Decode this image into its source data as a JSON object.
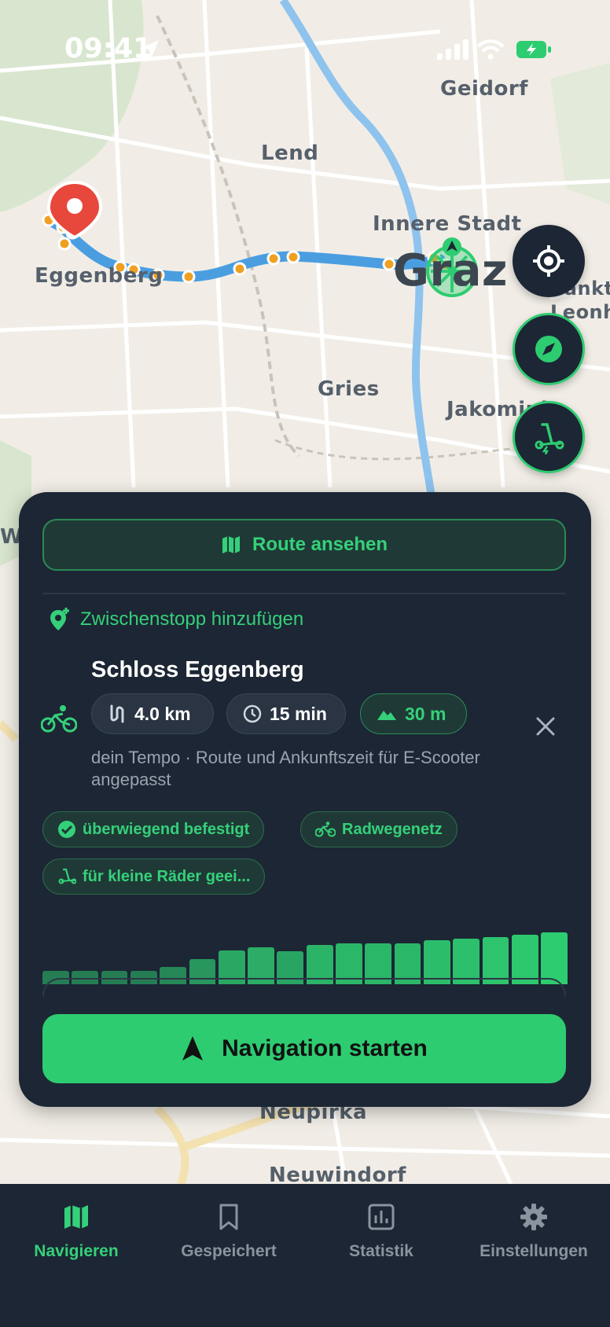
{
  "status_bar": {
    "time": "09:41"
  },
  "map": {
    "labels": {
      "geidorf": "Geidorf",
      "lend": "Lend",
      "innere_stadt": "Innere Stadt",
      "eggenberg": "Eggenberg",
      "graz": "Graz",
      "sankt_leonhard": "Sankt Leonhard",
      "gries": "Gries",
      "jakomini": "Jakomini",
      "neupirka": "Neupirka",
      "neuwindorf": "Neuwindorf",
      "west": "We"
    }
  },
  "panel": {
    "route_button": "Route ansehen",
    "add_stop": "Zwischenstopp hinzufügen",
    "destination": "Schloss Eggenberg",
    "stats": {
      "distance": "4.0 km",
      "duration": "15 min",
      "elevation": "30 m"
    },
    "description": "dein Tempo  ·  Route und Ankunftszeit für E-Scooter angepasst",
    "tags": [
      "überwiegend befestigt",
      "Radwegenetz",
      "für kleine Räder geei..."
    ],
    "elevation_profile": [
      0.15,
      0.15,
      0.15,
      0.15,
      0.25,
      0.42,
      0.6,
      0.68,
      0.58,
      0.72,
      0.76,
      0.76,
      0.76,
      0.83,
      0.86,
      0.9,
      0.94,
      1.0
    ],
    "start_button": "Navigation starten"
  },
  "tabs": [
    {
      "label": "Navigieren",
      "icon": "map-icon",
      "active": true
    },
    {
      "label": "Gespeichert",
      "icon": "bookmark-icon",
      "active": false
    },
    {
      "label": "Statistik",
      "icon": "chart-icon",
      "active": false
    },
    {
      "label": "Einstellungen",
      "icon": "gear-icon",
      "active": false
    }
  ],
  "colors": {
    "accent": "#2ecc71",
    "panel": "#1c2634",
    "route": "#4a9ee0",
    "marker": "#e8473b",
    "waypoint": "#f0a020"
  }
}
